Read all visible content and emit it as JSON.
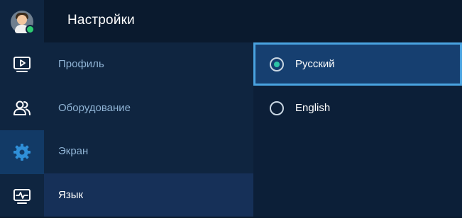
{
  "header": {
    "title": "Настройки"
  },
  "rail": {
    "items": [
      {
        "name": "avatar",
        "icon": "avatar-icon"
      },
      {
        "name": "video",
        "icon": "play-video-icon"
      },
      {
        "name": "people",
        "icon": "users-icon"
      },
      {
        "name": "settings",
        "icon": "gear-icon",
        "active": true
      },
      {
        "name": "monitor",
        "icon": "heartbeat-monitor-icon"
      }
    ]
  },
  "menu": {
    "items": [
      {
        "label": "Профиль"
      },
      {
        "label": "Оборудование"
      },
      {
        "label": "Экран"
      },
      {
        "label": "Язык",
        "selected": true
      }
    ]
  },
  "language_options": [
    {
      "label": "Русский",
      "checked": true,
      "focused": true
    },
    {
      "label": "English",
      "checked": false
    }
  ],
  "colors": {
    "accent": "#2f8fd8",
    "focus_border": "#4aa3e0",
    "radio_checked": "#2ec4a6",
    "online": "#2ecc71"
  }
}
